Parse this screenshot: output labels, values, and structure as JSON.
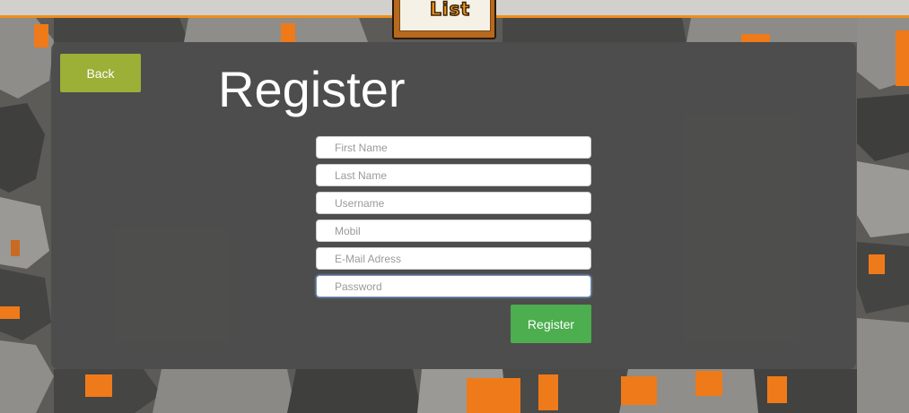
{
  "header": {
    "logo_text": "List"
  },
  "nav": {
    "back_label": "Back"
  },
  "page": {
    "title": "Register"
  },
  "form": {
    "fields": [
      {
        "placeholder": "First Name",
        "value": ""
      },
      {
        "placeholder": "Last Name",
        "value": ""
      },
      {
        "placeholder": "Username",
        "value": ""
      },
      {
        "placeholder": "Mobil",
        "value": ""
      },
      {
        "placeholder": "E-Mail Adress",
        "value": ""
      },
      {
        "placeholder": "Password",
        "value": ""
      }
    ],
    "submit_label": "Register"
  },
  "colors": {
    "accent_orange": "#f28c1d",
    "back_button": "#9caf36",
    "register_button": "#4cae4f",
    "panel": "#4b4b4b"
  }
}
